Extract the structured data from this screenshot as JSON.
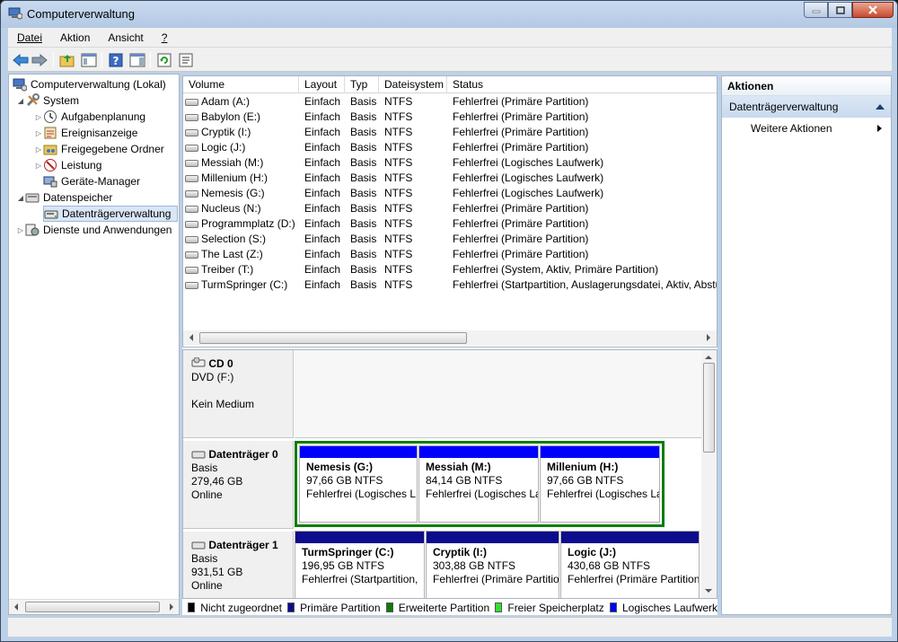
{
  "window": {
    "title": "Computerverwaltung"
  },
  "menu": [
    {
      "label": "Datei"
    },
    {
      "label": "Aktion"
    },
    {
      "label": "Ansicht"
    },
    {
      "label": "?"
    }
  ],
  "tree": {
    "root": "Computerverwaltung (Lokal)",
    "system": "System",
    "aufgaben": "Aufgabenplanung",
    "ereignis": "Ereignisanzeige",
    "freigabe": "Freigegebene Ordner",
    "leistung": "Leistung",
    "geraete": "Geräte-Manager",
    "datenspeicher": "Datenspeicher",
    "datentraeger": "Datenträgerverwaltung",
    "dienste": "Dienste und Anwendungen"
  },
  "volumes": {
    "columns": [
      "Volume",
      "Layout",
      "Typ",
      "Dateisystem",
      "Status"
    ],
    "rows": [
      [
        "Adam (A:)",
        "Einfach",
        "Basis",
        "NTFS",
        "Fehlerfrei (Primäre Partition)"
      ],
      [
        "Babylon (E:)",
        "Einfach",
        "Basis",
        "NTFS",
        "Fehlerfrei (Primäre Partition)"
      ],
      [
        "Cryptik (I:)",
        "Einfach",
        "Basis",
        "NTFS",
        "Fehlerfrei (Primäre Partition)"
      ],
      [
        "Logic (J:)",
        "Einfach",
        "Basis",
        "NTFS",
        "Fehlerfrei (Primäre Partition)"
      ],
      [
        "Messiah (M:)",
        "Einfach",
        "Basis",
        "NTFS",
        "Fehlerfrei (Logisches Laufwerk)"
      ],
      [
        "Millenium (H:)",
        "Einfach",
        "Basis",
        "NTFS",
        "Fehlerfrei (Logisches Laufwerk)"
      ],
      [
        "Nemesis (G:)",
        "Einfach",
        "Basis",
        "NTFS",
        "Fehlerfrei (Logisches Laufwerk)"
      ],
      [
        "Nucleus (N:)",
        "Einfach",
        "Basis",
        "NTFS",
        "Fehlerfrei (Primäre Partition)"
      ],
      [
        "Programmplatz (D:)",
        "Einfach",
        "Basis",
        "NTFS",
        "Fehlerfrei (Primäre Partition)"
      ],
      [
        "Selection (S:)",
        "Einfach",
        "Basis",
        "NTFS",
        "Fehlerfrei (Primäre Partition)"
      ],
      [
        "The Last (Z:)",
        "Einfach",
        "Basis",
        "NTFS",
        "Fehlerfrei (Primäre Partition)"
      ],
      [
        "Treiber (T:)",
        "Einfach",
        "Basis",
        "NTFS",
        "Fehlerfrei (System, Aktiv, Primäre Partition)"
      ],
      [
        "TurmSpringer (C:)",
        "Einfach",
        "Basis",
        "NTFS",
        "Fehlerfrei (Startpartition, Auslagerungsdatei, Aktiv, Abstu"
      ]
    ]
  },
  "disks": {
    "cd0": {
      "name": "CD 0",
      "type": "DVD (F:)",
      "status": "Kein Medium"
    },
    "disk0": {
      "name": "Datenträger 0",
      "type": "Basis",
      "size": "279,46 GB",
      "status": "Online",
      "parts": [
        {
          "name": "Nemesis  (G:)",
          "size": "97,66 GB NTFS",
          "status": "Fehlerfrei (Logisches L"
        },
        {
          "name": "Messiah  (M:)",
          "size": "84,14 GB NTFS",
          "status": "Fehlerfrei (Logisches La"
        },
        {
          "name": "Millenium  (H:)",
          "size": "97,66 GB NTFS",
          "status": "Fehlerfrei (Logisches La"
        }
      ]
    },
    "disk1": {
      "name": "Datenträger 1",
      "type": "Basis",
      "size": "931,51 GB",
      "status": "Online",
      "parts": [
        {
          "name": "TurmSpringer  (C:)",
          "size": "196,95 GB NTFS",
          "status": "Fehlerfrei (Startpartition,"
        },
        {
          "name": "Cryptik  (I:)",
          "size": "303,88 GB NTFS",
          "status": "Fehlerfrei (Primäre Partition"
        },
        {
          "name": "Logic  (J:)",
          "size": "430,68 GB NTFS",
          "status": "Fehlerfrei (Primäre Partition"
        }
      ]
    }
  },
  "legend": [
    {
      "label": "Nicht zugeordnet",
      "color": "#000000"
    },
    {
      "label": "Primäre Partition",
      "color": "#0c0c8c"
    },
    {
      "label": "Erweiterte Partition",
      "color": "#0b7d0b"
    },
    {
      "label": "Freier Speicherplatz",
      "color": "#32e032"
    },
    {
      "label": "Logisches Laufwerk",
      "color": "#0000ff"
    }
  ],
  "actions": {
    "header": "Aktionen",
    "section": "Datenträgerverwaltung",
    "more": "Weitere Aktionen"
  },
  "colors": {
    "primary": "#0c0c8c",
    "logical": "#0000ff",
    "extended": "#0b7d0b"
  }
}
